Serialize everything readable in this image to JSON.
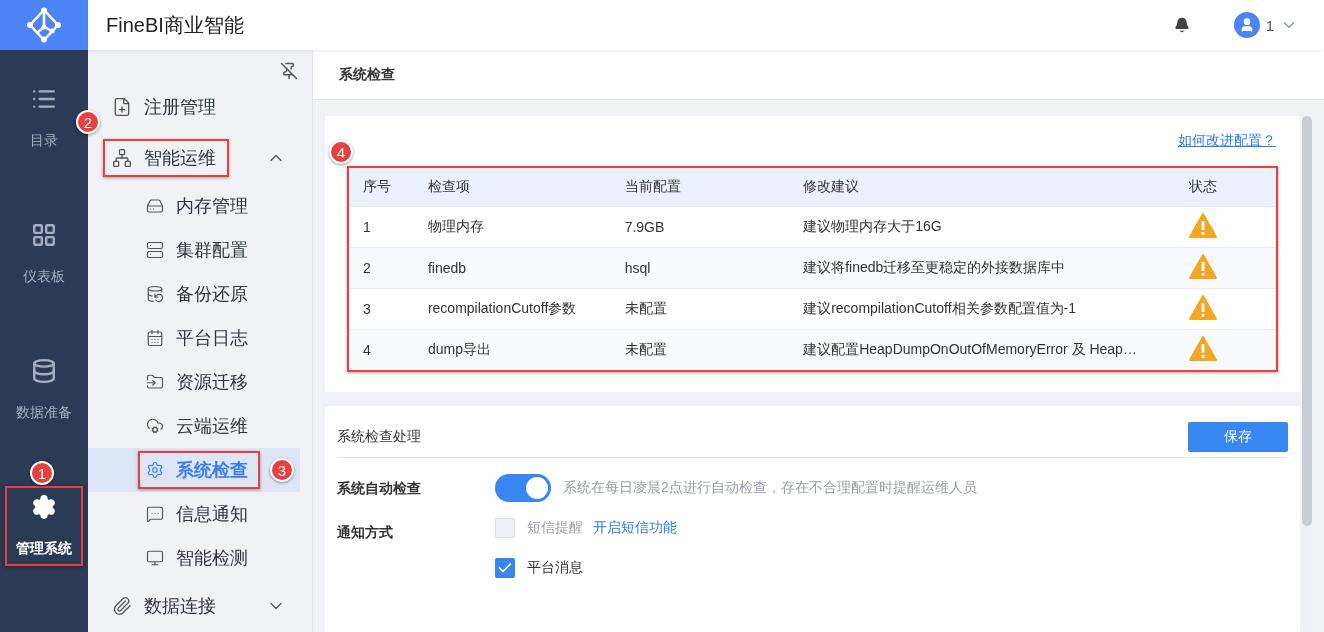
{
  "app_title": "FineBI商业智能",
  "user": {
    "name": "1"
  },
  "rail": [
    {
      "label": "目录",
      "selected": false,
      "highlighted": false
    },
    {
      "label": "仪表板",
      "selected": false,
      "highlighted": false
    },
    {
      "label": "数据准备",
      "selected": false,
      "highlighted": false
    },
    {
      "label": "管理系统",
      "selected": true,
      "highlighted": true,
      "badge": "1"
    }
  ],
  "sidebar": {
    "items": [
      {
        "label": "注册管理",
        "selected": false,
        "highlighted": false
      },
      {
        "label": "智能运维",
        "selected": false,
        "highlighted": true,
        "badge": "2",
        "expanded": true,
        "children": [
          {
            "label": "内存管理",
            "selected": false,
            "highlighted": false
          },
          {
            "label": "集群配置",
            "selected": false,
            "highlighted": false
          },
          {
            "label": "备份还原",
            "selected": false,
            "highlighted": false
          },
          {
            "label": "平台日志",
            "selected": false,
            "highlighted": false
          },
          {
            "label": "资源迁移",
            "selected": false,
            "highlighted": false
          },
          {
            "label": "云端运维",
            "selected": false,
            "highlighted": false
          },
          {
            "label": "系统检查",
            "selected": true,
            "highlighted": true,
            "badge": "3"
          },
          {
            "label": "信息通知",
            "selected": false,
            "highlighted": false
          },
          {
            "label": "智能检测",
            "selected": false,
            "highlighted": false
          }
        ]
      },
      {
        "label": "数据连接",
        "selected": false,
        "highlighted": false,
        "expanded": false
      }
    ]
  },
  "page_title": "系统检查",
  "check_card": {
    "help_link": "如何改进配置？",
    "table": {
      "badge": "4",
      "highlighted": true,
      "columns": [
        "序号",
        "检查项",
        "当前配置",
        "修改建议",
        "状态"
      ],
      "rows": [
        {
          "cells": [
            "1",
            "物理内存",
            "7.9GB",
            "建议物理内存大于16G"
          ],
          "kind": "warning"
        },
        {
          "cells": [
            "2",
            "finedb",
            "hsql",
            "建议将finedb迁移至更稳定的外接数据库中"
          ],
          "kind": "warning"
        },
        {
          "cells": [
            "3",
            "recompilationCutoff参数",
            "未配置",
            "建议recompilationCutoff相关参数配置值为-1"
          ],
          "kind": "warning"
        },
        {
          "cells": [
            "4",
            "dump导出",
            "未配置",
            "建议配置HeapDumpOnOutOfMemoryError 及 Heap…"
          ],
          "kind": "warning"
        }
      ]
    }
  },
  "handling": {
    "title": "系统检查处理",
    "save_button": "保存",
    "settings": [
      {
        "kind": "switch",
        "label": "系统自动检查",
        "on": true,
        "description": "系统在每日凌晨2点进行自动检查，存在不合理配置时提醒运维人员"
      },
      {
        "kind": "checks",
        "label": "通知方式",
        "options": [
          {
            "label": "短信提醒",
            "checked": false,
            "disabled": true,
            "link": "开启短信功能"
          },
          {
            "label": "平台消息",
            "checked": true,
            "disabled": false
          }
        ]
      }
    ]
  }
}
